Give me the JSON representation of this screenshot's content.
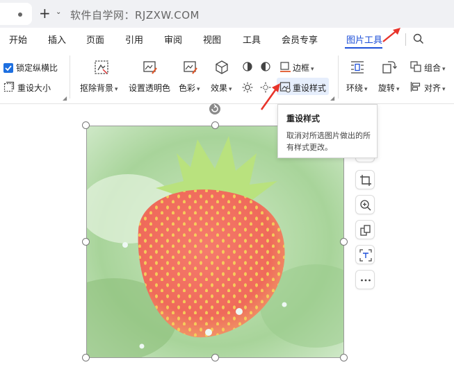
{
  "titlebar": {
    "new_tab_symbol": "+",
    "site_title": "软件自学网：RJZXW.COM"
  },
  "menu": {
    "items": [
      "开始",
      "插入",
      "页面",
      "引用",
      "审阅",
      "视图",
      "工具",
      "会员专享",
      "图片工具"
    ],
    "active_index": 8
  },
  "ribbon": {
    "lock_ratio": "锁定纵横比",
    "lock_ratio_checked": true,
    "resize": "重设大小",
    "remove_bg": "抠除背景",
    "set_transparent": "设置透明色",
    "color": "色彩",
    "effects": "效果",
    "border": "边框",
    "reset_style": "重设样式",
    "wrap": "环绕",
    "rotate": "旋转",
    "group": "组合",
    "align": "对齐"
  },
  "tooltip": {
    "title": "重设样式",
    "body": "取消对所选图片做出的所有样式更改。"
  },
  "colors": {
    "accent": "#1d4fd8",
    "arrow": "#e8342b",
    "checkbox": "#1d6fe0"
  }
}
